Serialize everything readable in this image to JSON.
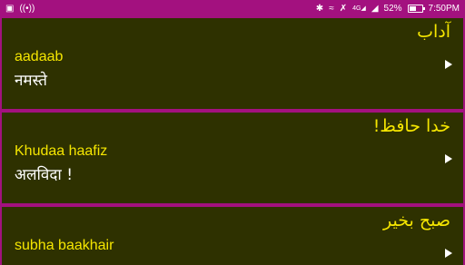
{
  "status_bar": {
    "left_icons": [
      "image-icon",
      "broadcast-icon"
    ],
    "right_icons": [
      "bluetooth-icon",
      "wifi-icon",
      "mute-icon",
      "signal-4g-icon",
      "signal-icon"
    ],
    "battery_percent": "52%",
    "battery_level": 0.52,
    "time": "7:50PM"
  },
  "phrases": [
    {
      "urdu": "آداب",
      "transliteration": "aadaab",
      "hindi": "नमस्ते"
    },
    {
      "urdu": "خدا حافظ!",
      "transliteration": "Khudaa haafiz",
      "hindi": "अलविदा !"
    },
    {
      "urdu": "صبح بخیر",
      "transliteration": "subha baakhair",
      "hindi": ""
    }
  ],
  "colors": {
    "accent": "#a3117f",
    "card_background": "#2e3100",
    "primary_text": "#f5e600",
    "secondary_text": "#ffffff"
  }
}
